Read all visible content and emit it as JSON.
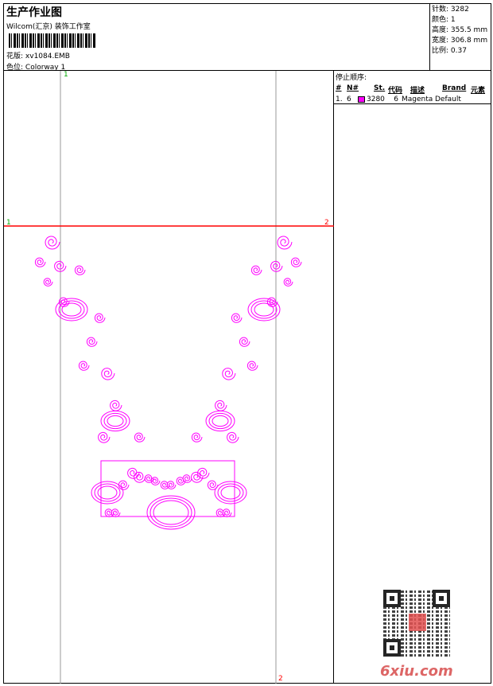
{
  "header": {
    "title": "生产作业图",
    "company": "Wilcom(汇京) 装饰工作室",
    "design_label": "花版:",
    "design_value": "xv1084.EMB",
    "colorway_label": "色位:",
    "colorway_value": "Colorway 1"
  },
  "stats": [
    {
      "label": "针数:",
      "value": "3282"
    },
    {
      "label": "颜色:",
      "value": "1"
    },
    {
      "label": "高度:",
      "value": "355.5 mm"
    },
    {
      "label": "宽度:",
      "value": "306.8 mm"
    },
    {
      "label": "比例:",
      "value": "0.37"
    }
  ],
  "stop_sequence": {
    "title": "停止顺序:",
    "columns": [
      "#",
      "N#",
      "St.",
      "代码",
      "描述",
      "Brand",
      "元素"
    ],
    "rows": [
      {
        "index": "1.",
        "needle": "6",
        "color": "#ff00ff",
        "stitches": "3280",
        "code": "6",
        "description": "Magenta",
        "brand": "Default",
        "elements": ""
      }
    ]
  },
  "guides": {
    "v1": "1",
    "h1": "1",
    "h2": "2",
    "v2": "2"
  },
  "watermark": "6xiu.com",
  "colors": {
    "thread": "#ff00ff",
    "guide_red": "#ff0000",
    "guide_green": "#00aa00"
  }
}
